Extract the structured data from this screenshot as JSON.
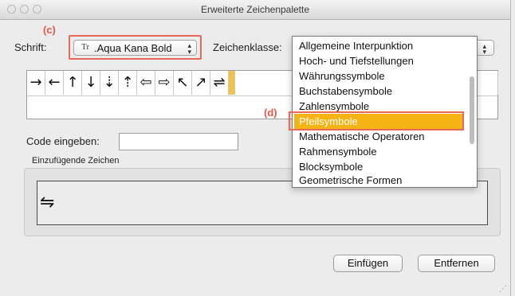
{
  "window": {
    "title": "Erweiterte Zeichenpalette"
  },
  "callouts": {
    "c": "(c)",
    "d": "(d)"
  },
  "font": {
    "label": "Schrift:",
    "icon_glyph": "Tr",
    "value": ".Aqua Kana Bold",
    "arrows": "⌃⌄"
  },
  "char_class": {
    "label": "Zeichenklasse:"
  },
  "glyphs": {
    "row1": [
      "→",
      "←",
      "↑",
      "↓",
      "⇣",
      "⇡",
      "⇦",
      "⇨",
      "↖",
      "↗",
      "⇌"
    ]
  },
  "code": {
    "label": "Code eingeben:",
    "value": ""
  },
  "insert": {
    "group_label": "Einzufügende Zeichen",
    "chars": "⇋"
  },
  "buttons": {
    "insert": "Einfügen",
    "remove": "Entfernen"
  },
  "dropdown": {
    "items": [
      "Allgemeine Interpunktion",
      "Hoch- und Tiefstellungen",
      "Währungssymbole",
      "Buchstabensymbole",
      "Zahlensymbole",
      "Pfeilsymbole",
      "Mathematische Operatoren",
      "Rahmensymbole",
      "Blocksymbole",
      "Geometrische Formen"
    ],
    "selected": "Pfeilsymbole"
  },
  "colors": {
    "accent_selected": "#f5b414",
    "callout": "#e2584a"
  }
}
